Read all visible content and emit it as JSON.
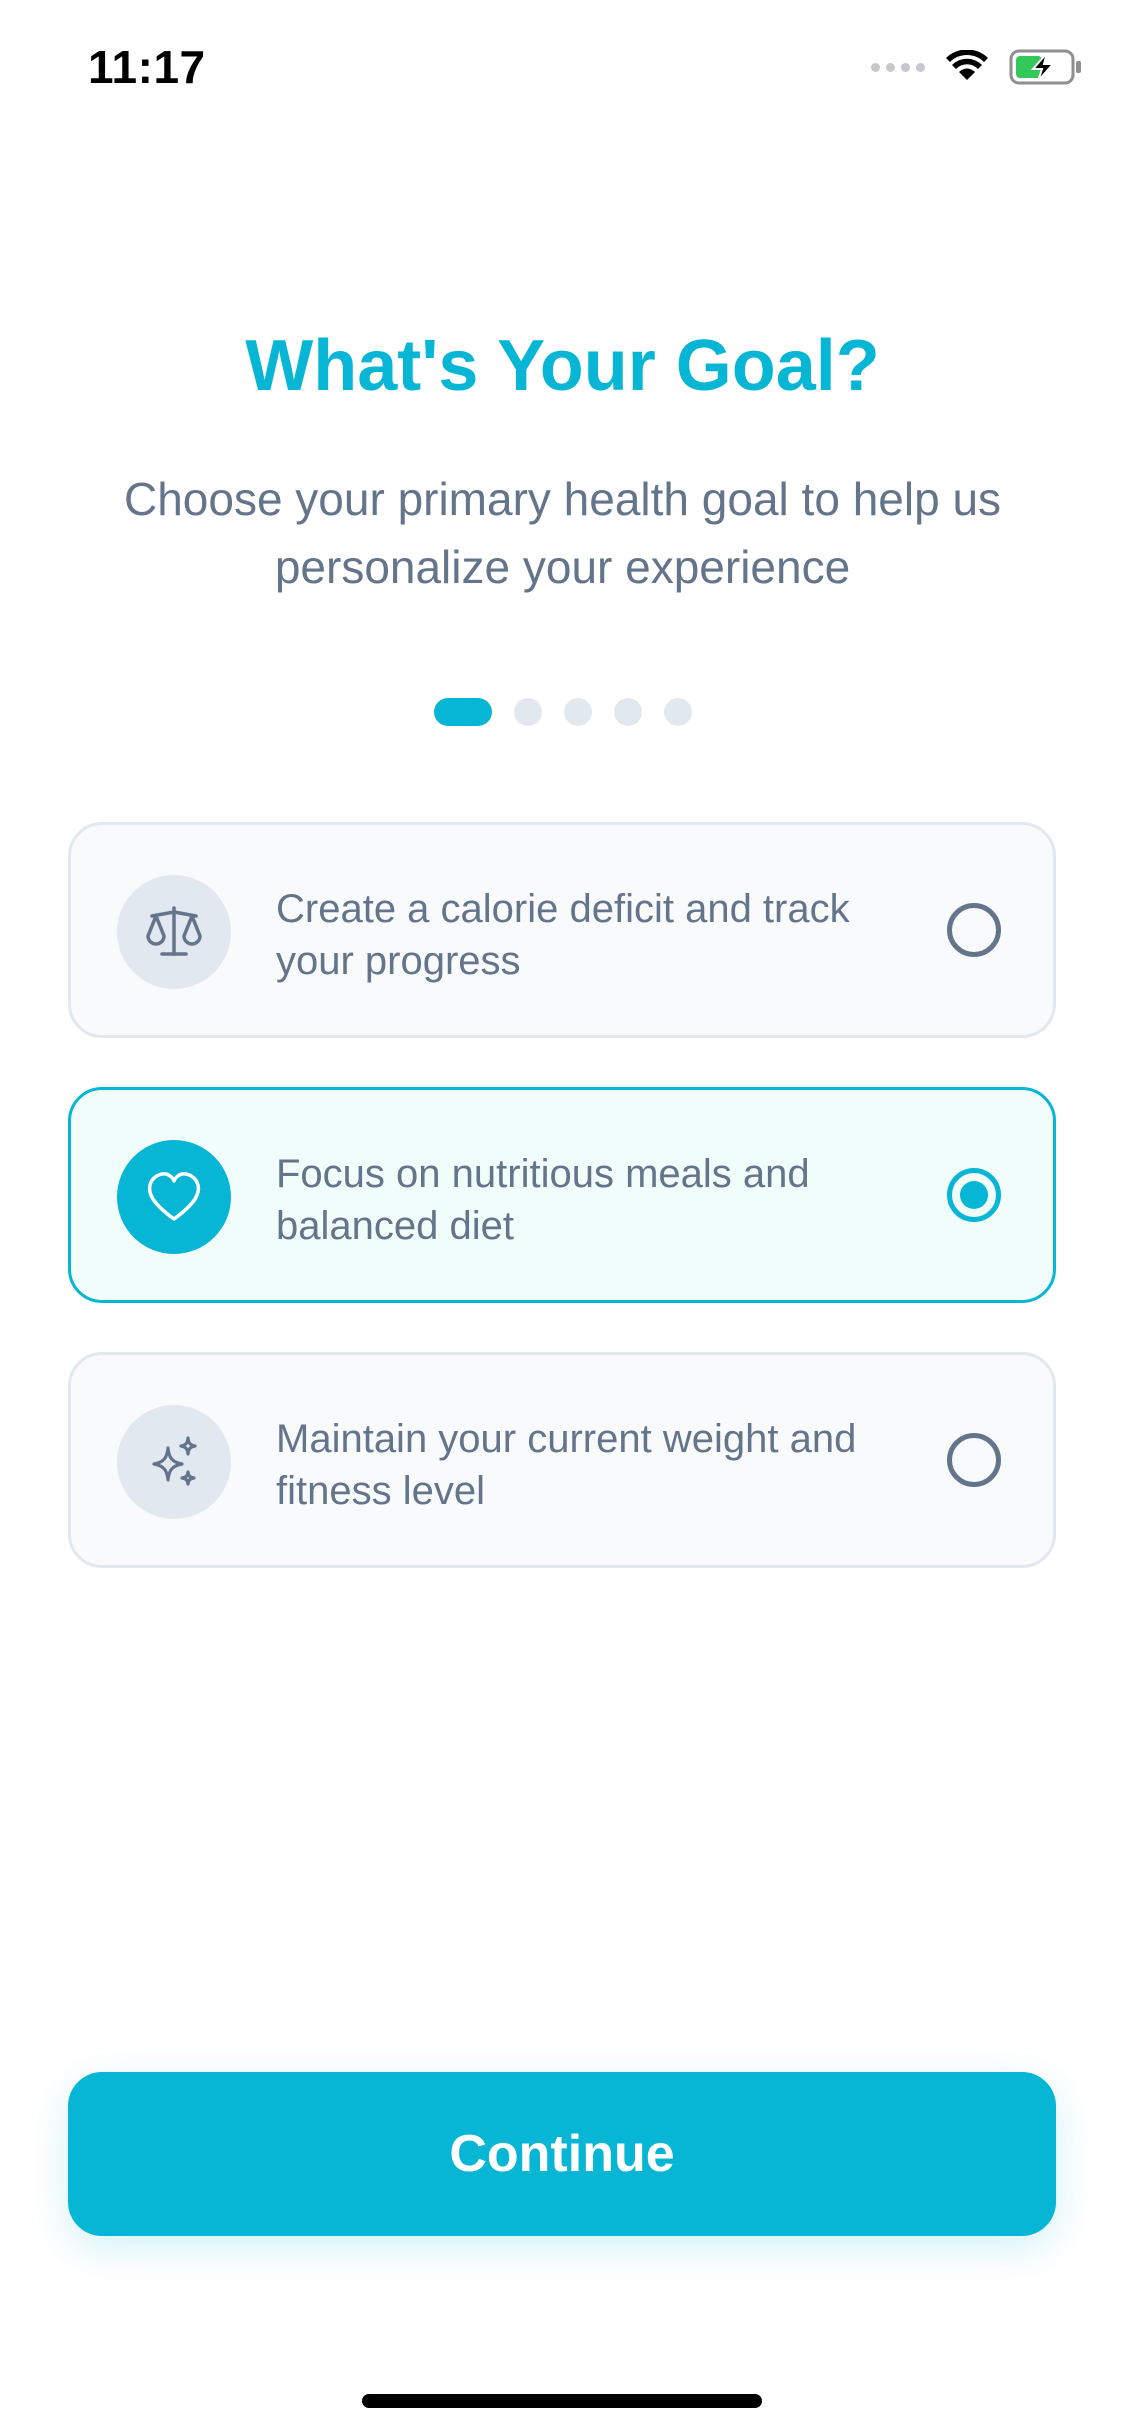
{
  "status_bar": {
    "time": "11:17",
    "signal_icon": "cellular-signal-icon",
    "wifi_icon": "wifi-icon",
    "battery_icon": "battery-charging-icon",
    "battery_color": "#34c759"
  },
  "header": {
    "title": "What's Your Goal?",
    "subtitle": "Choose your primary health goal to help us personalize your experience"
  },
  "progress": {
    "total_steps": 5,
    "current_step": 1
  },
  "goals": [
    {
      "icon": "scale-icon",
      "description": "Create a calorie deficit and track your progress",
      "selected": false
    },
    {
      "icon": "heart-icon",
      "description": "Focus on nutritious meals and balanced diet",
      "selected": true
    },
    {
      "icon": "sparkles-icon",
      "description": "Maintain your current weight and fitness level",
      "selected": false
    }
  ],
  "footer": {
    "continue_label": "Continue"
  },
  "colors": {
    "accent": "#06b6d4",
    "text_muted": "#64748b",
    "card_bg": "#f8fafc",
    "card_selected_bg": "#f0fdfa",
    "border": "#e2e8f0"
  }
}
